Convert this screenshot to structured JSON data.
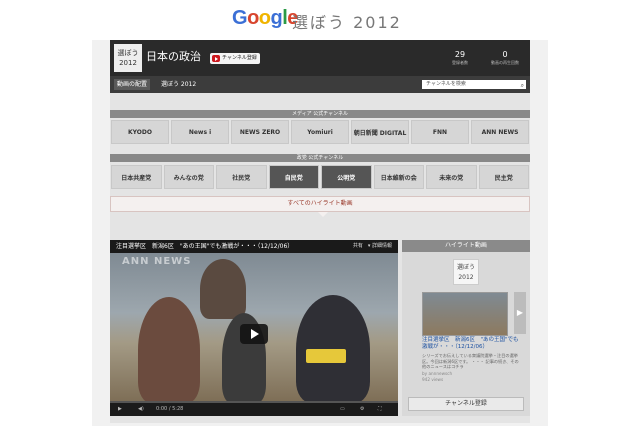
{
  "google_logo": [
    "G",
    "o",
    "o",
    "g",
    "l",
    "e"
  ],
  "google_logo_colors": [
    "#3b6fd6",
    "#d8452e",
    "#f0b400",
    "#3b6fd6",
    "#2a9a46",
    "#d8452e"
  ],
  "page_subtitle": "選ぼう 2012",
  "channel": {
    "avatar_text": "選ぼう 2012",
    "title": "日本の政治",
    "subscribe_label": "チャンネル登録",
    "stats": [
      {
        "value": "29",
        "label": "登録者数"
      },
      {
        "value": "0",
        "label": "動画の再生回数"
      }
    ]
  },
  "tabs": [
    {
      "label": "動画の配置"
    },
    {
      "label": "選ぼう 2012"
    }
  ],
  "search": {
    "placeholder": "チャンネルを検索"
  },
  "media_section": {
    "title": "メディア 公式チャンネル",
    "logos": [
      {
        "name": "KYODO",
        "style": "light"
      },
      {
        "name": "News i",
        "style": "light"
      },
      {
        "name": "NEWS ZERO",
        "style": "light"
      },
      {
        "name": "Yomiuri",
        "style": "light"
      },
      {
        "name": "朝日新聞 DIGITAL",
        "style": "light"
      },
      {
        "name": "FNN",
        "style": "light"
      },
      {
        "name": "ANN NEWS",
        "style": "light"
      }
    ]
  },
  "party_section": {
    "title": "政党 公式チャンネル",
    "logos": [
      {
        "name": "日本共産党",
        "style": "light"
      },
      {
        "name": "みんなの党",
        "style": "light"
      },
      {
        "name": "社民党",
        "style": "light"
      },
      {
        "name": "自民党",
        "style": "dark"
      },
      {
        "name": "公明党",
        "style": "dark"
      },
      {
        "name": "日本維新の会",
        "style": "light"
      },
      {
        "name": "未来の党",
        "style": "light"
      },
      {
        "name": "民主党",
        "style": "light"
      }
    ]
  },
  "highlight_bar": "すべてのハイライト動画",
  "video": {
    "title": "注目選挙区　新潟6区　\"あの王国\"でも激戦が・・・（12/12/06）",
    "share": "共有　▾ 詳細情報",
    "watermark": "ANN NEWS",
    "time": "0:00 / 5:28",
    "progress": 0
  },
  "sidebar": {
    "title": "ハイライト動画",
    "logo_text": "選ぼう 2012",
    "video_title": "注目選挙区　新潟6区　\"あの王国\"でも激戦が・・・（12/12/06）",
    "description": "シリーズでお伝えしている衆議院選挙・注目の選挙区。今回は新潟6区です。 ・・・ 記事の続き、その他のニュースはコチラ",
    "author": "by annnewsch",
    "views": "942 views",
    "subscribe_label": "チャンネル登録"
  }
}
